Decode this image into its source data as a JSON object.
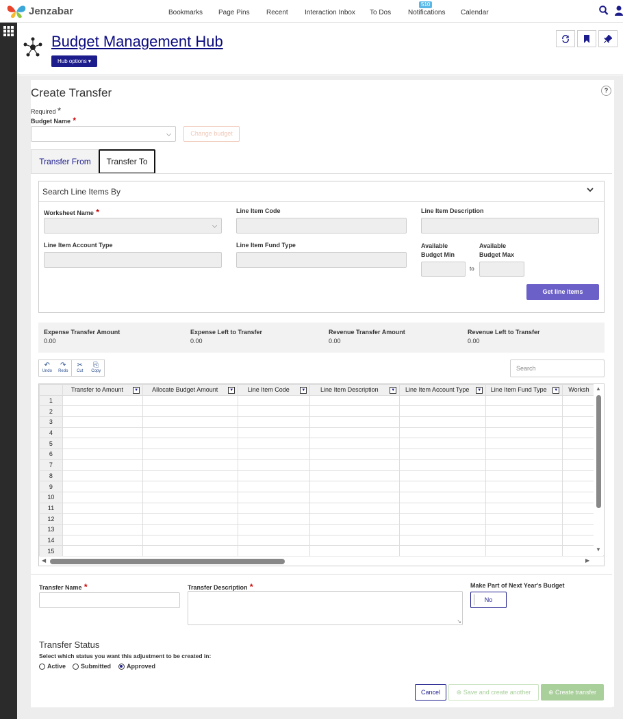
{
  "app": {
    "brand": "Jenzabar"
  },
  "nav": {
    "items": [
      "Bookmarks",
      "Page Pins",
      "Recent",
      "Interaction Inbox",
      "To Dos",
      "Notifications",
      "Calendar"
    ],
    "notifications_count": "510"
  },
  "hub": {
    "title": "Budget Management Hub",
    "options_label": "Hub options"
  },
  "page": {
    "title": "Create Transfer",
    "help": "?",
    "required_note": "Required",
    "budget_name_label": "Budget Name",
    "change_budget": "Change budget"
  },
  "tabs": [
    "Transfer From",
    "Transfer To"
  ],
  "search": {
    "title": "Search Line Items By",
    "worksheet_name": "Worksheet Name",
    "line_item_code": "Line Item Code",
    "line_item_description": "Line Item Description",
    "line_item_account_type": "Line Item Account Type",
    "line_item_fund_type": "Line Item Fund Type",
    "available_budget_min": "Available Budget Min",
    "available_budget_max": "Available Budget Max",
    "to": "to",
    "get_line_items": "Get line items"
  },
  "summary": [
    {
      "label": "Expense Transfer Amount",
      "value": "0.00"
    },
    {
      "label": "Expense Left to Transfer",
      "value": "0.00"
    },
    {
      "label": "Revenue Transfer Amount",
      "value": "0.00"
    },
    {
      "label": "Revenue Left to Transfer",
      "value": "0.00"
    }
  ],
  "toolbar": [
    "Undo",
    "Redo",
    "Cut",
    "Copy"
  ],
  "grid_search_placeholder": "Search",
  "grid": {
    "columns": [
      "Transfer to Amount",
      "Allocate Budget Amount",
      "Line Item Code",
      "Line Item Description",
      "Line Item Account Type",
      "Line Item Fund Type",
      "Worksh"
    ],
    "rows": [
      "1",
      "2",
      "3",
      "4",
      "5",
      "6",
      "7",
      "8",
      "9",
      "10",
      "11",
      "12",
      "13",
      "14",
      "15"
    ]
  },
  "form": {
    "transfer_name": "Transfer Name",
    "transfer_description": "Transfer Description",
    "next_year_label": "Make Part of Next Year's Budget",
    "next_year_value": "No",
    "status_title": "Transfer Status",
    "status_prompt": "Select which status you want this adjustment to be created in:",
    "statuses": [
      "Active",
      "Submitted",
      "Approved"
    ],
    "selected_status": "Approved"
  },
  "actions": {
    "cancel": "Cancel",
    "save_another": "Save and create another",
    "create": "Create transfer"
  },
  "colors": {
    "accent": "#1c1c8c",
    "primary_button": "#6b5fc8",
    "required": "#cc0000",
    "disabled_green": "#a9cf9b"
  }
}
